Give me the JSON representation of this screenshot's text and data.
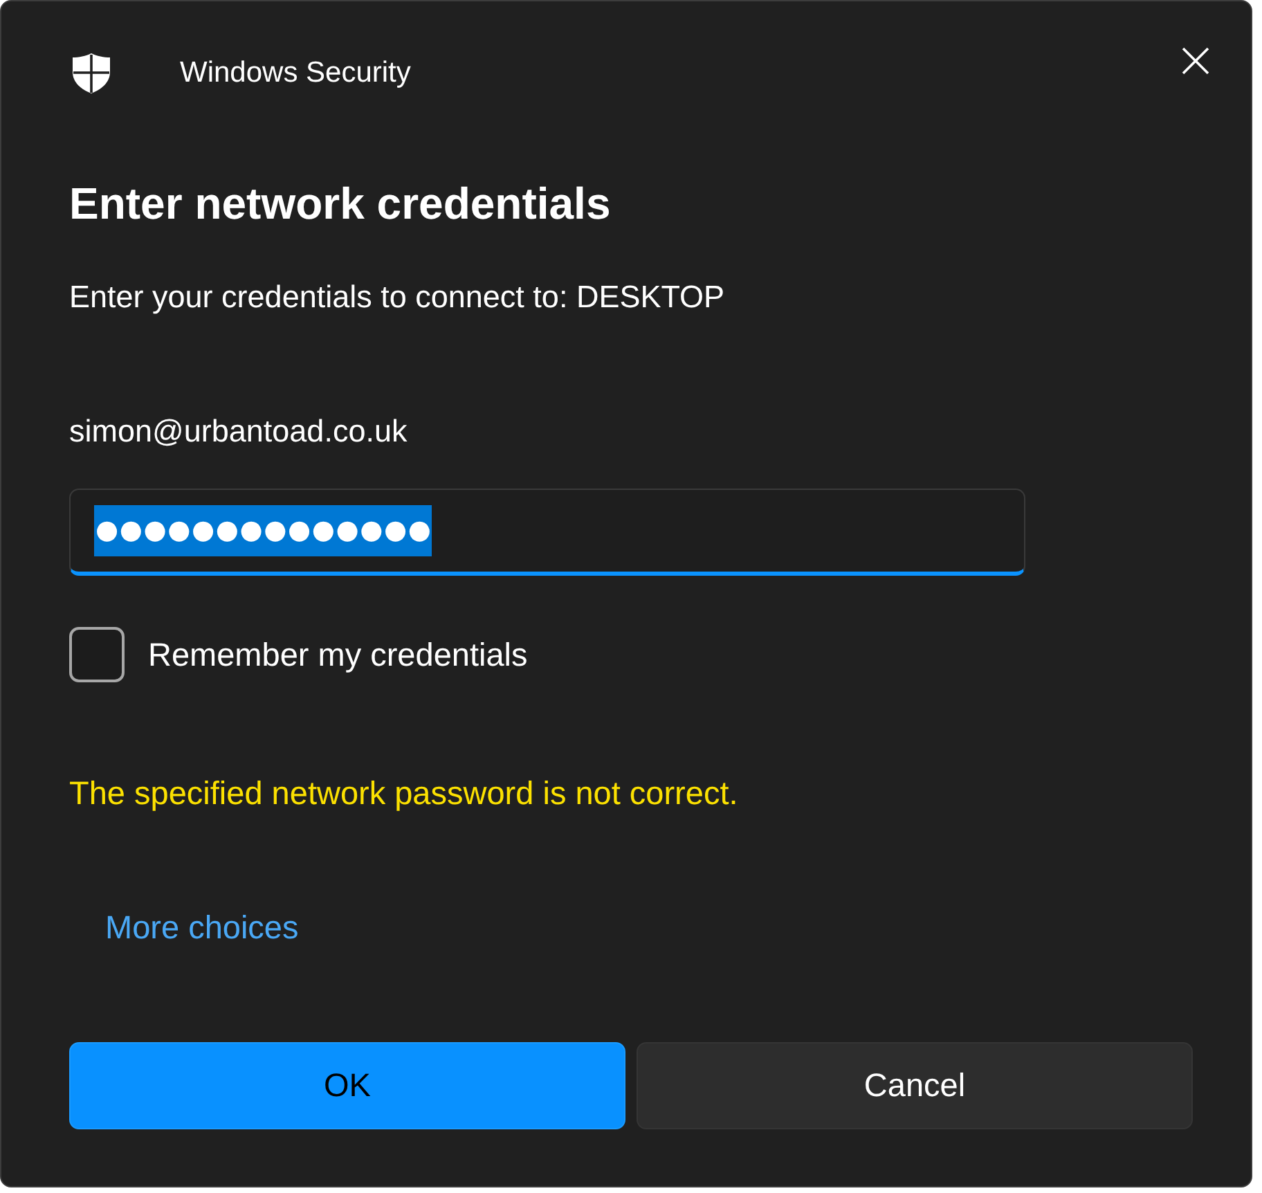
{
  "window": {
    "title": "Windows Security"
  },
  "heading": "Enter network credentials",
  "prompt": "Enter your credentials to connect to: DESKTOP",
  "username": "simon@urbantoad.co.uk",
  "password": {
    "value": "●●●●●●●●●●●●●●",
    "text_selected": true,
    "focused": true
  },
  "remember": {
    "label": "Remember my credentials",
    "checked": false
  },
  "error": "The specified network password is not correct.",
  "link": "More choices",
  "buttons": [
    {
      "label": "OK",
      "kind": "primary"
    },
    {
      "label": "Cancel",
      "kind": "secondary"
    }
  ]
}
